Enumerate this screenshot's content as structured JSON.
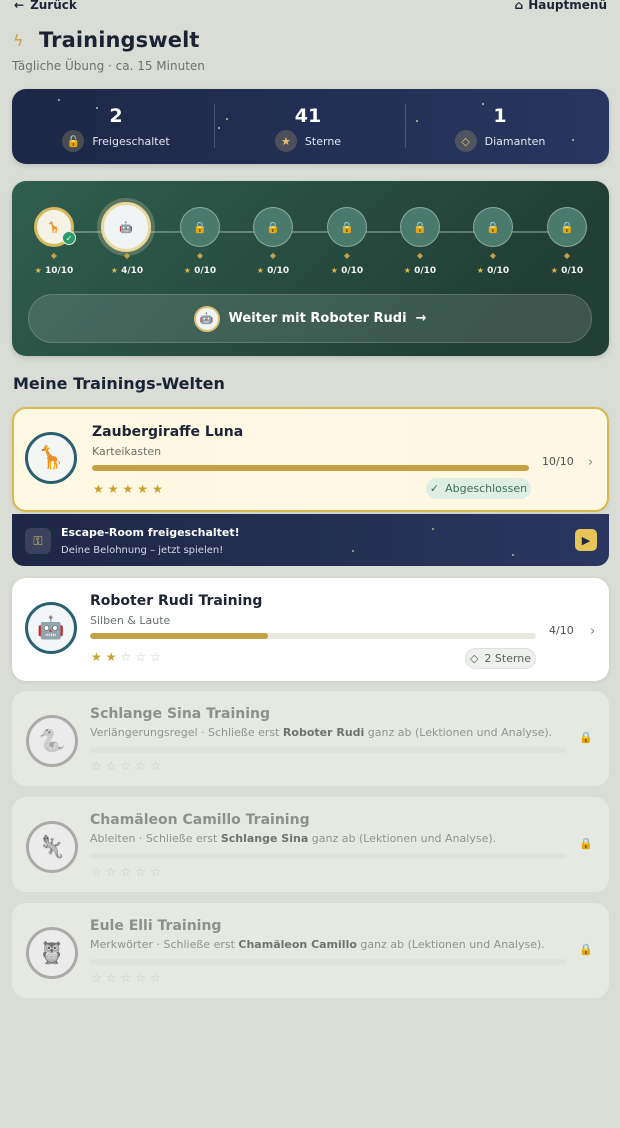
{
  "nav": {
    "back_arrow": "←",
    "back_label": "Zurück",
    "home_icon": "⌂",
    "home_label": "Hauptmenü"
  },
  "header": {
    "bolt": "ϟ",
    "title": "Trainingswelt",
    "subtitle": "Tägliche Übung · ca. 15 Minuten"
  },
  "stats": [
    {
      "value": "2",
      "label": "Freigeschaltet",
      "icon": "lock-icon",
      "glyph": "🔓"
    },
    {
      "value": "41",
      "label": "Sterne",
      "icon": "star-icon",
      "glyph": "★"
    },
    {
      "value": "1",
      "label": "Diamanten",
      "icon": "diamond-icon",
      "glyph": "◇"
    }
  ],
  "path": {
    "nodes": [
      {
        "score": "10/10",
        "state": "completed"
      },
      {
        "score": "4/10",
        "state": "current"
      },
      {
        "score": "0/10",
        "state": "locked"
      },
      {
        "score": "0/10",
        "state": "locked"
      },
      {
        "score": "0/10",
        "state": "locked"
      },
      {
        "score": "0/10",
        "state": "locked"
      },
      {
        "score": "0/10",
        "state": "locked"
      },
      {
        "score": "0/10",
        "state": "locked"
      }
    ],
    "continue_label": "Weiter mit Roboter Rudi",
    "continue_arrow": "→"
  },
  "section_title": "Meine Trainings-Welten",
  "worlds": [
    {
      "title": "Zaubergiraffe Luna",
      "subtitle": "Karteikasten",
      "count": "10/10",
      "progress": 1.0,
      "stars": 5,
      "badge": "Abgeschlossen",
      "badge_icon": "✓",
      "state": "completed"
    },
    {
      "title": "Roboter Rudi Training",
      "subtitle": "Silben & Laute",
      "count": "4/10",
      "progress": 0.4,
      "stars": 2,
      "badge": "2 Sterne",
      "badge_icon": "◇",
      "state": "active"
    },
    {
      "title": "Schlange Sina Training",
      "sub_prefix": "Verlängerungsregel · Schließe erst ",
      "sub_bold": "Roboter Rudi",
      "sub_suffix": " ganz ab (Lektionen und Analyse).",
      "stars": 0,
      "state": "locked"
    },
    {
      "title": "Chamäleon Camillo Training",
      "sub_prefix": "Ableiten · Schließe erst ",
      "sub_bold": "Schlange Sina",
      "sub_suffix": " ganz ab (Lektionen und Analyse).",
      "stars": 0,
      "state": "locked"
    },
    {
      "title": "Eule Elli Training",
      "sub_prefix": "Merkwörter · Schließe erst ",
      "sub_bold": "Chamäleon Camillo",
      "sub_suffix": " ganz ab (Lektionen und Analyse).",
      "stars": 0,
      "state": "locked"
    }
  ],
  "escape": {
    "title": "Escape-Room freigeschaltet!",
    "subtitle": "Deine Belohnung – jetzt spielen!",
    "key_glyph": "⚿",
    "play_glyph": "▶"
  },
  "glyphs": {
    "star": "★",
    "star_empty": "☆",
    "lock": "🔒",
    "gem": "◆",
    "check": "✓",
    "chevron": "›"
  },
  "colors": {
    "navy": "#1d2747",
    "green": "#2f5e4f",
    "gold": "#c9a12f",
    "completed_green": "#2e9b67"
  }
}
